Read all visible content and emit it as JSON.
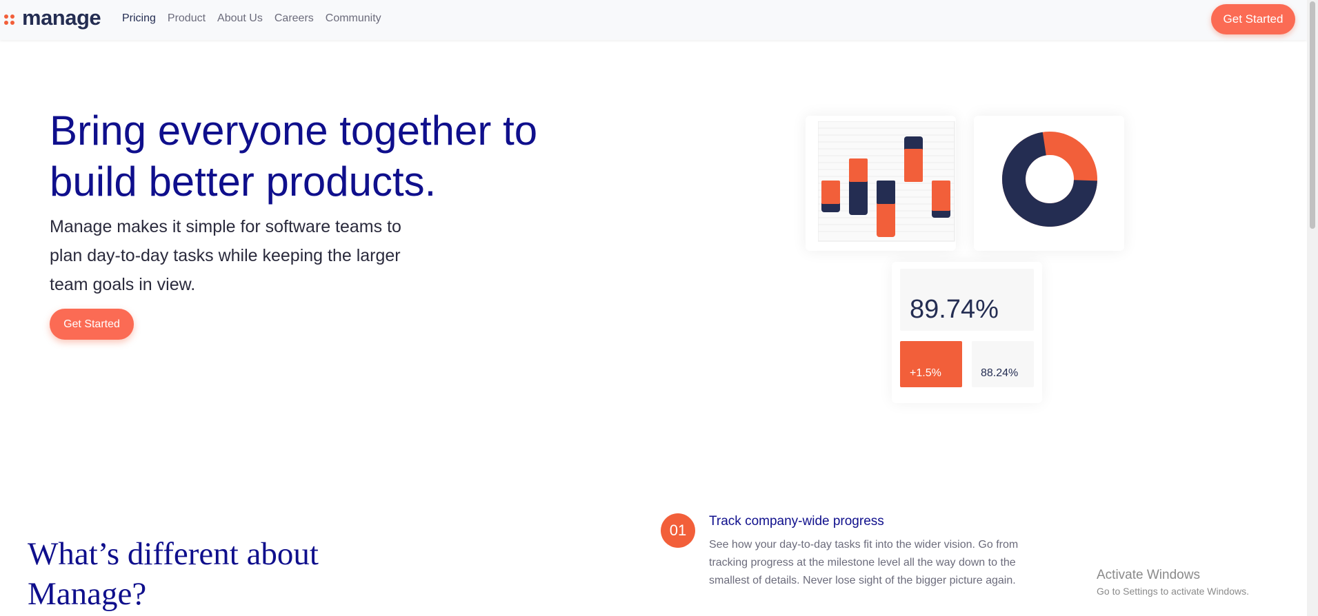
{
  "brand": {
    "name": "manage",
    "accent": "#f25f3a",
    "navy": "#242d52",
    "heading_color": "#0f0f8c"
  },
  "nav": {
    "links": [
      {
        "label": "Pricing",
        "active": true
      },
      {
        "label": "Product"
      },
      {
        "label": "About Us"
      },
      {
        "label": "Careers"
      },
      {
        "label": "Community"
      }
    ],
    "cta_label": "Get Started"
  },
  "hero": {
    "title": "Bring everyone together to build better products.",
    "description": "Manage makes it simple for software teams to plan day-to-day tasks while keeping the larger team goals in view.",
    "cta_label": "Get Started"
  },
  "illustration": {
    "main_stat": "89.74%",
    "change_stat": "+1.5%",
    "secondary_stat": "88.24%",
    "donut_fraction": 0.72
  },
  "features": {
    "title": "What’s different about Manage?",
    "items": [
      {
        "number": "01",
        "heading": "Track company-wide progress",
        "text": "See how your day-to-day tasks fit into the wider vision. Go from tracking progress at the milestone level all the way down to the smallest of details. Never lose sight of the bigger picture again."
      }
    ]
  },
  "watermark": {
    "title": "Activate Windows",
    "subtitle": "Go to Settings to activate Windows."
  }
}
